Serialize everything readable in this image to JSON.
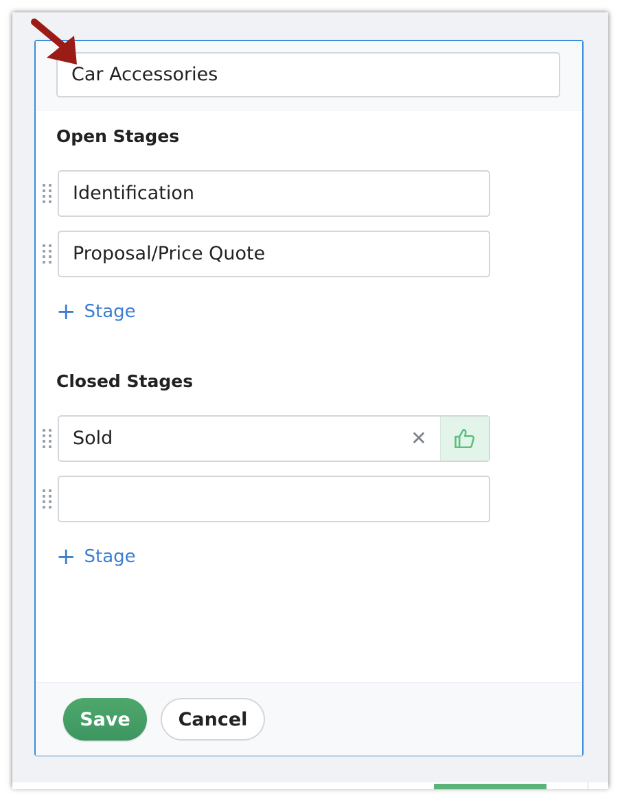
{
  "pipeline": {
    "name_value": "Car Accessories"
  },
  "open_stages": {
    "title": "Open Stages",
    "items": [
      {
        "value": "Identification"
      },
      {
        "value": "Proposal/Price Quote"
      }
    ],
    "add_label": "Stage"
  },
  "closed_stages": {
    "title": "Closed Stages",
    "items": [
      {
        "value": "Sold",
        "status": "won"
      },
      {
        "value": ""
      }
    ],
    "add_label": "Stage"
  },
  "footer": {
    "save_label": "Save",
    "cancel_label": "Cancel"
  },
  "icons": {
    "drag": "drag-handle-icon",
    "clear": "close-icon",
    "won": "thumbs-up-icon",
    "add": "plus-icon",
    "annotation": "arrow-icon"
  },
  "colors": {
    "accent_blue": "#3b7ed0",
    "panel_border": "#3b8cdc",
    "save_green": "#4ea86d",
    "won_bg": "#e3f5ea",
    "won_icon": "#5bbf7f",
    "arrow": "#9b1c17"
  }
}
